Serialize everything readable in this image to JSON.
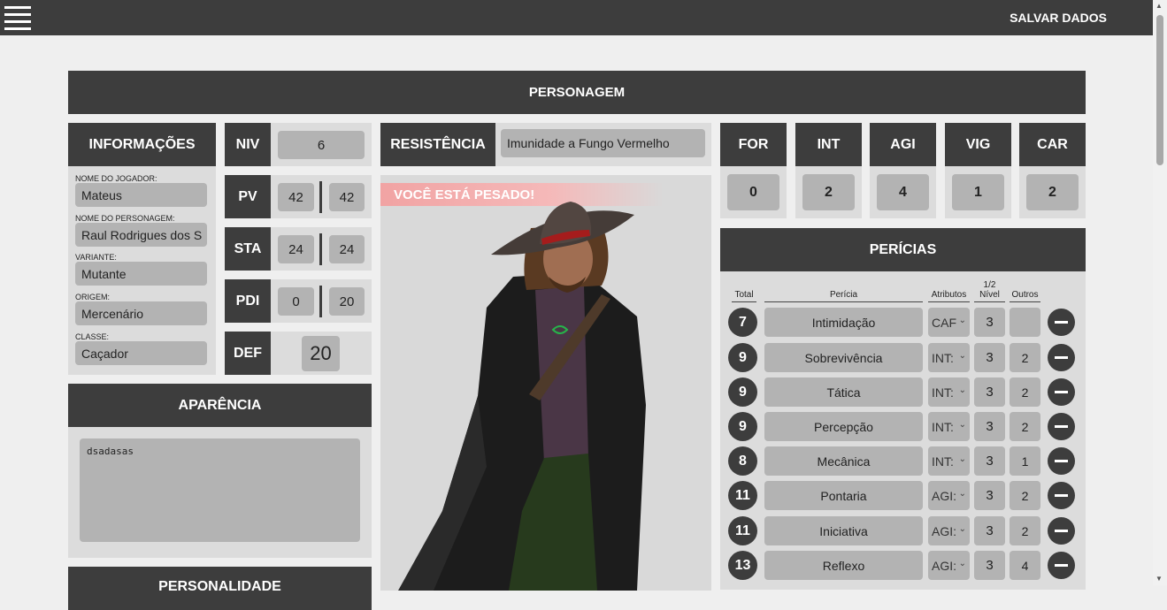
{
  "topbar": {
    "save_label": "SALVAR DADOS"
  },
  "header": {
    "title": "PERSONAGEM"
  },
  "info": {
    "title": "INFORMAÇÕES",
    "fields": [
      {
        "label": "NOME DO JOGADOR:",
        "value": "Mateus"
      },
      {
        "label": "NOME DO PERSONAGEM:",
        "value": "Raul Rodrigues dos S"
      },
      {
        "label": "VARIANTE:",
        "value": "Mutante"
      },
      {
        "label": "ORIGEM:",
        "value": "Mercenário"
      },
      {
        "label": "CLASSE:",
        "value": "Caçador"
      }
    ]
  },
  "stats": {
    "niv": {
      "label": "NIV",
      "value": "6"
    },
    "pv": {
      "label": "PV",
      "current": "42",
      "max": "42"
    },
    "sta": {
      "label": "STA",
      "current": "24",
      "max": "24"
    },
    "pdi": {
      "label": "PDI",
      "current": "0",
      "max": "20"
    },
    "def": {
      "label": "DEF",
      "value": "20"
    }
  },
  "resistance": {
    "label": "RESISTÊNCIA",
    "value": "Imunidade a Fungo Vermelho"
  },
  "portrait": {
    "warning": "VOCÊ ESTÁ PESADO!"
  },
  "attributes": [
    {
      "label": "FOR",
      "value": "0"
    },
    {
      "label": "INT",
      "value": "2"
    },
    {
      "label": "AGI",
      "value": "4"
    },
    {
      "label": "VIG",
      "value": "1"
    },
    {
      "label": "CAR",
      "value": "2"
    }
  ],
  "skills": {
    "title": "PERÍCIAS",
    "headers": {
      "total": "Total",
      "skill": "Perícia",
      "attr": "Atributos",
      "half_top": "1/2",
      "half_bottom": "Nível",
      "other": "Outros"
    },
    "rows": [
      {
        "total": "7",
        "name": "Intimidação",
        "attr": "CAF",
        "half": "3",
        "other": ""
      },
      {
        "total": "9",
        "name": "Sobrevivência",
        "attr": "INT:",
        "half": "3",
        "other": "2"
      },
      {
        "total": "9",
        "name": "Tática",
        "attr": "INT:",
        "half": "3",
        "other": "2"
      },
      {
        "total": "9",
        "name": "Percepção",
        "attr": "INT:",
        "half": "3",
        "other": "2"
      },
      {
        "total": "8",
        "name": "Mecânica",
        "attr": "INT:",
        "half": "3",
        "other": "1"
      },
      {
        "total": "11",
        "name": "Pontaria",
        "attr": "AGI:",
        "half": "3",
        "other": "2"
      },
      {
        "total": "11",
        "name": "Iniciativa",
        "attr": "AGI:",
        "half": "3",
        "other": "2"
      },
      {
        "total": "13",
        "name": "Reflexo",
        "attr": "AGI:",
        "half": "3",
        "other": "4"
      }
    ]
  },
  "appearance": {
    "title": "APARÊNCIA",
    "text": "dsadasas"
  },
  "personality": {
    "title": "PERSONALIDADE"
  }
}
